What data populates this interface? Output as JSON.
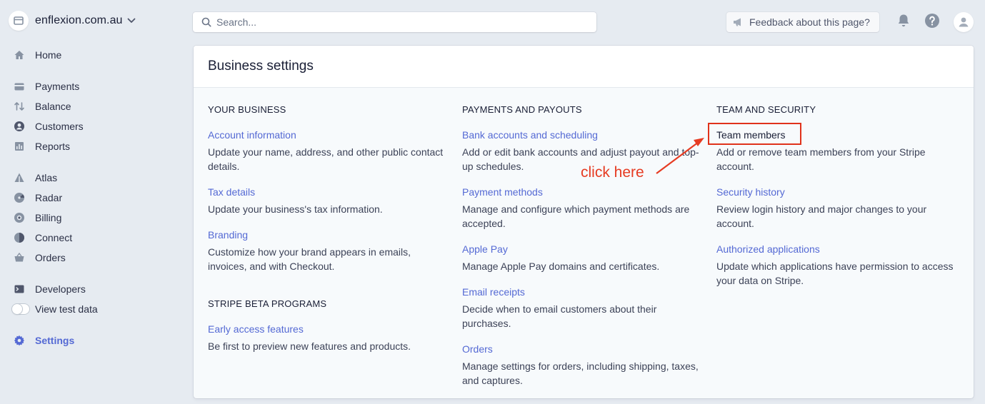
{
  "account": {
    "name": "enflexion.com.au"
  },
  "sidebar": {
    "items": [
      {
        "label": "Home",
        "icon": "home-icon"
      },
      {
        "label": "Payments",
        "icon": "payments-icon"
      },
      {
        "label": "Balance",
        "icon": "balance-icon"
      },
      {
        "label": "Customers",
        "icon": "customers-icon"
      },
      {
        "label": "Reports",
        "icon": "reports-icon"
      },
      {
        "label": "Atlas",
        "icon": "atlas-icon"
      },
      {
        "label": "Radar",
        "icon": "radar-icon"
      },
      {
        "label": "Billing",
        "icon": "billing-icon"
      },
      {
        "label": "Connect",
        "icon": "connect-icon"
      },
      {
        "label": "Orders",
        "icon": "orders-icon"
      },
      {
        "label": "Developers",
        "icon": "developers-icon"
      },
      {
        "label": "View test data",
        "icon": "toggle"
      },
      {
        "label": "Settings",
        "icon": "settings-icon",
        "active": true
      }
    ]
  },
  "topbar": {
    "search_placeholder": "Search...",
    "feedback_label": "Feedback about this page?"
  },
  "panel": {
    "title": "Business settings",
    "columns": [
      {
        "sections": [
          {
            "heading": "YOUR BUSINESS",
            "items": [
              {
                "link": "Account information",
                "desc": "Update your name, address, and other public contact details."
              },
              {
                "link": "Tax details",
                "desc": "Update your business's tax information."
              },
              {
                "link": "Branding",
                "desc": "Customize how your brand appears in emails, invoices, and with Checkout."
              }
            ]
          },
          {
            "heading": "STRIPE BETA PROGRAMS",
            "items": [
              {
                "link": "Early access features",
                "desc": "Be first to preview new features and products."
              }
            ]
          }
        ]
      },
      {
        "sections": [
          {
            "heading": "PAYMENTS AND PAYOUTS",
            "items": [
              {
                "link": "Bank accounts and scheduling",
                "desc": "Add or edit bank accounts and adjust payout and top-up schedules."
              },
              {
                "link": "Payment methods",
                "desc": "Manage and configure which payment methods are accepted."
              },
              {
                "link": "Apple Pay",
                "desc": "Manage Apple Pay domains and certificates."
              },
              {
                "link": "Email receipts",
                "desc": "Decide when to email customers about their purchases."
              },
              {
                "link": "Orders",
                "desc": "Manage settings for orders, including shipping, taxes, and captures."
              }
            ]
          }
        ]
      },
      {
        "sections": [
          {
            "heading": "TEAM AND SECURITY",
            "items": [
              {
                "link": "Team members",
                "desc": "Add or remove team members from your Stripe account."
              },
              {
                "link": "Security history",
                "desc": "Review login history and major changes to your account."
              },
              {
                "link": "Authorized applications",
                "desc": "Update which applications have permission to access your data on Stripe."
              }
            ]
          }
        ]
      }
    ]
  },
  "annotation": {
    "text": "click here",
    "color": "#e63b22"
  },
  "colors": {
    "accent": "#5469d4",
    "background": "#e6ebf1",
    "panel": "#f7fafc",
    "annotation_box": "#e0321b"
  }
}
